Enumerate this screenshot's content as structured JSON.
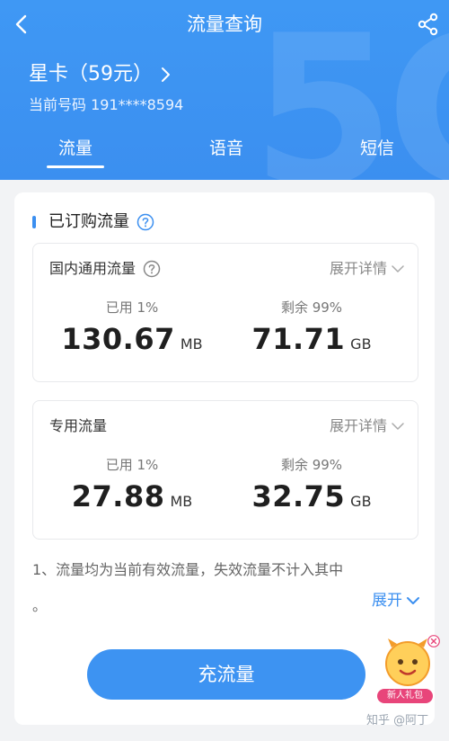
{
  "header": {
    "title": "流量查询",
    "plan": "星卡（59元）",
    "phone": "当前号码 191****8594",
    "tabs": [
      "流量",
      "语音",
      "短信"
    ],
    "active_tab": "流量",
    "brand_color": "#3b8ff0"
  },
  "section": {
    "title": "已订购流量"
  },
  "usage": [
    {
      "title": "国内通用流量",
      "expand": "展开详情",
      "used_label": "已用 1%",
      "used_value": "130.67",
      "used_unit": "MB",
      "remaining_label": "剩余 99%",
      "remaining_value": "71.71",
      "remaining_unit": "GB"
    },
    {
      "title": "专用流量",
      "expand": "展开详情",
      "used_label": "已用 1%",
      "used_value": "27.88",
      "used_unit": "MB",
      "remaining_label": "剩余 99%",
      "remaining_value": "32.75",
      "remaining_unit": "GB"
    }
  ],
  "note": {
    "text": "1、流量均为当前有效流量，失效流量不计入其中",
    "cont": "。",
    "expand": "展开"
  },
  "actions": {
    "recharge": "充流量"
  },
  "promo": {
    "label": "新人礼包"
  },
  "watermark": "知乎 @阿丁",
  "icons": [
    "back-icon",
    "share-icon",
    "chevron-right-icon",
    "help-icon",
    "chevron-down-icon",
    "close-icon"
  ]
}
